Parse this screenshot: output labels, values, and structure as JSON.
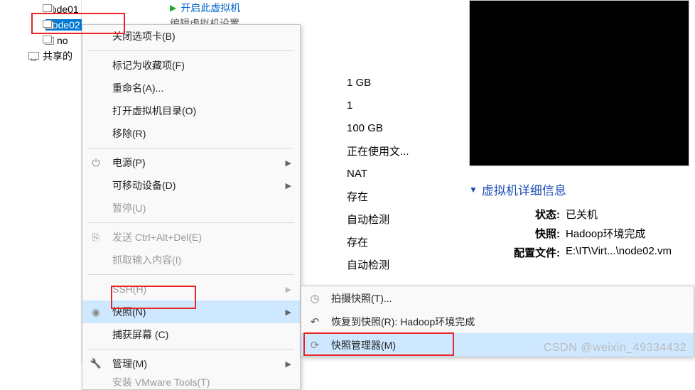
{
  "sidebar": {
    "items": [
      {
        "label": "node01"
      },
      {
        "label": "node02"
      },
      {
        "label": "no"
      }
    ],
    "shared_label": "共享的"
  },
  "center": {
    "start_label": "开启此虚拟机",
    "edit_label": "编辑虚拟机设置"
  },
  "context_menu": {
    "close_tab": "关闭选项卡(B)",
    "favorite": "标记为收藏项(F)",
    "rename": "重命名(A)...",
    "open_dir": "打开虚拟机目录(O)",
    "remove": "移除(R)",
    "power": "电源(P)",
    "removable": "可移动设备(D)",
    "pause": "暂停(U)",
    "send_cad": "发送 Ctrl+Alt+Del(E)",
    "grab_input": "抓取输入内容(I)",
    "ssh": "SSH(H)",
    "snapshot": "快照(N)",
    "capture": "捕获屏幕 (C)",
    "manage": "管理(M)",
    "install_tools": "安装 VMware Tools(T)"
  },
  "submenu": {
    "take": "拍摄快照(T)...",
    "revert": "恢复到快照(R): Hadoop环境完成",
    "manager": "快照管理器(M)"
  },
  "specs": {
    "memory": "1 GB",
    "cpu": "1",
    "disk": "100 GB",
    "cd": "正在使用文...",
    "net": "NAT",
    "usb": "存在",
    "sound": "自动检测",
    "printer": "存在",
    "display": "自动检测"
  },
  "details": {
    "header": "虚拟机详细信息",
    "state_label": "状态:",
    "state_value": "已关机",
    "snap_label": "快照:",
    "snap_value": "Hadoop环境完成",
    "config_label": "配置文件:",
    "config_value": "E:\\IT\\Virt...\\node02.vm"
  },
  "watermark": "CSDN @weixin_49334432"
}
